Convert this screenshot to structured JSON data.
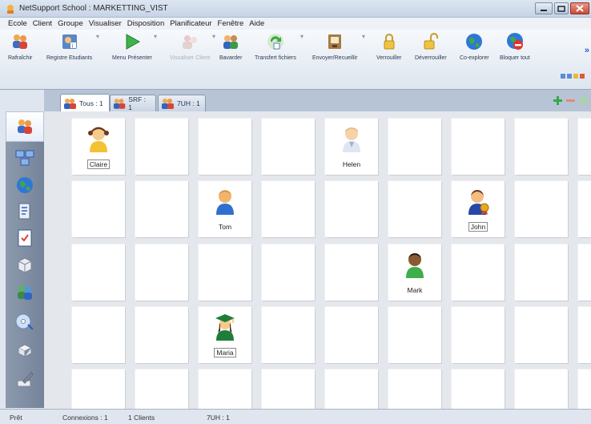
{
  "window": {
    "title": "NetSupport School : MARKETTING_VIST",
    "controls": [
      "minimize-icon",
      "maximize-icon",
      "close-icon"
    ]
  },
  "menu": [
    "Ecole",
    "Client",
    "Groupe",
    "Visualiser",
    "Disposition",
    "Planificateur",
    "Fenêtre",
    "Aide"
  ],
  "toolbar": [
    {
      "label": "Rafraîchir",
      "icon": "refresh-students-icon",
      "enabled": true
    },
    {
      "label": "Registre Etudiants",
      "icon": "student-register-icon",
      "enabled": true
    },
    {
      "label": "Menu Présenter",
      "icon": "present-play-icon",
      "enabled": true
    },
    {
      "label": "Visualiser Client",
      "icon": "view-client-icon",
      "enabled": false
    },
    {
      "label": "Bavarder",
      "icon": "chat-icon",
      "enabled": true
    },
    {
      "label": "Transfert fichiers",
      "icon": "file-transfer-icon",
      "enabled": true
    },
    {
      "label": "Envoyer/Recueillir",
      "icon": "send-collect-icon",
      "enabled": true
    },
    {
      "label": "Verrouiller",
      "icon": "lock-icon",
      "enabled": true
    },
    {
      "label": "Déverrouiller",
      "icon": "unlock-icon",
      "enabled": true
    },
    {
      "label": "Co-explorer",
      "icon": "globe-icon",
      "enabled": true
    },
    {
      "label": "Bloquer tout",
      "icon": "block-all-icon",
      "enabled": true
    }
  ],
  "tabs": [
    {
      "label": "Tous : 1",
      "active": true
    },
    {
      "label": "SRF : 1",
      "active": false
    },
    {
      "label": "7UH : 1",
      "active": false
    }
  ],
  "students": [
    {
      "name": "Claire",
      "avatar": "girl-student-icon",
      "selected": true
    },
    {
      "name": "Helen",
      "avatar": "elderly-student-icon",
      "selected": false
    },
    {
      "name": "Tom",
      "avatar": "boy-student-icon",
      "selected": false
    },
    {
      "name": "John",
      "avatar": "award-student-icon",
      "selected": true
    },
    {
      "name": "Mark",
      "avatar": "dark-student-icon",
      "selected": false
    },
    {
      "name": "Maria",
      "avatar": "graduate-student-icon",
      "selected": true
    }
  ],
  "sidebar_icons": [
    "students-group-icon",
    "computers-icon",
    "globe-icon",
    "document-icon",
    "checklist-icon",
    "box-icon",
    "users-icon",
    "disc-icon",
    "package-icon",
    "edit-icon"
  ],
  "status": {
    "ready": "Prêt",
    "connections": "Connexions : 1",
    "clients": "1 Clients",
    "group": "7UH : 1"
  }
}
